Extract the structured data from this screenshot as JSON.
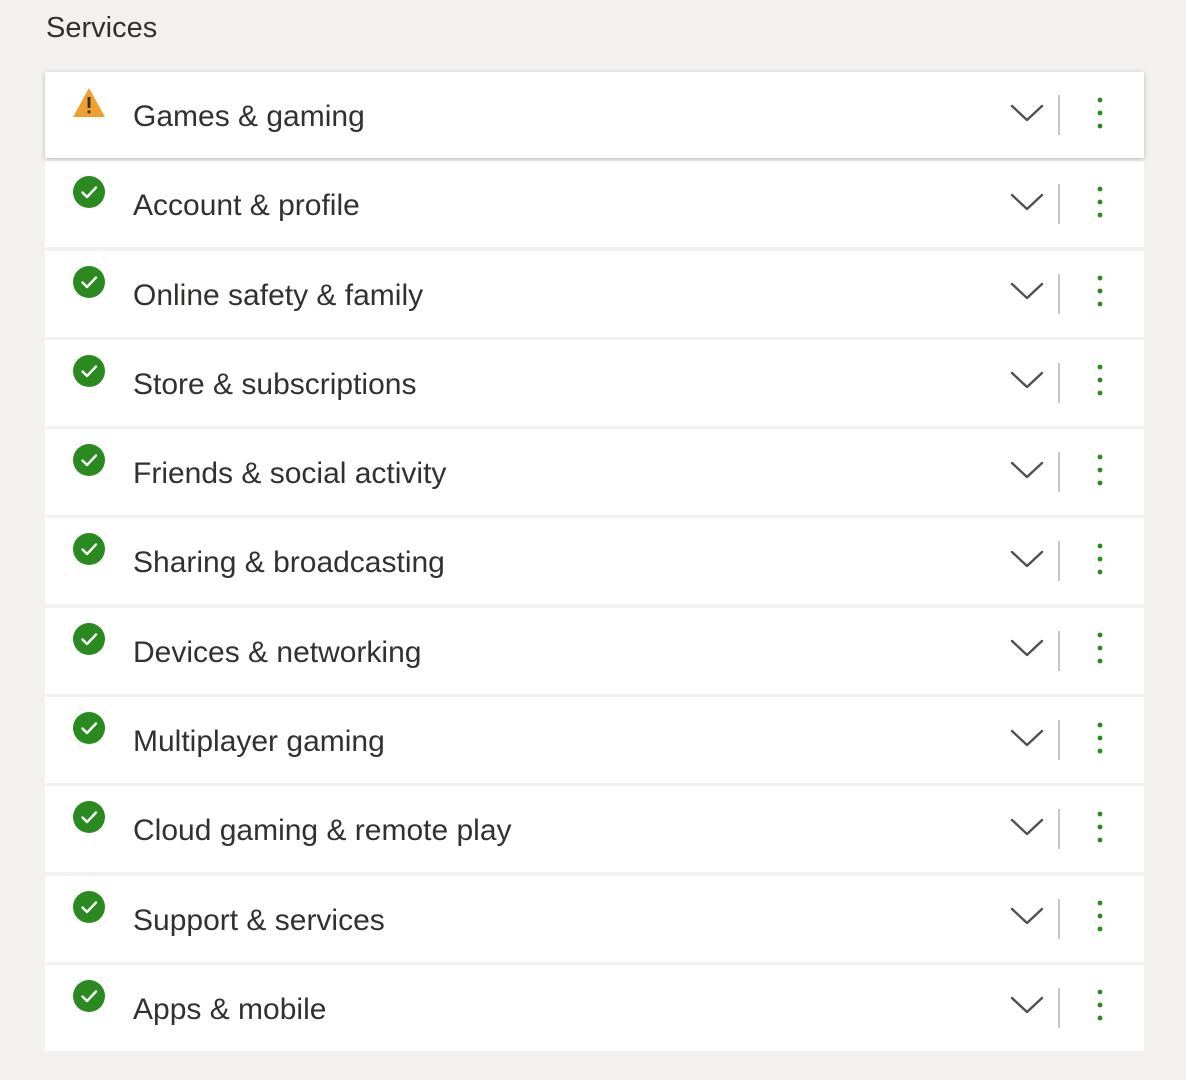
{
  "section": {
    "title": "Services"
  },
  "colors": {
    "ok": "#2b8a1f",
    "warning": "#f0a030",
    "more": "#2b8a1f",
    "chevron": "#505050"
  },
  "services": [
    {
      "label": "Games & gaming",
      "status": "warning",
      "icon": "warning-icon"
    },
    {
      "label": "Account & profile",
      "status": "ok",
      "icon": "check-circle-icon"
    },
    {
      "label": "Online safety & family",
      "status": "ok",
      "icon": "check-circle-icon"
    },
    {
      "label": "Store & subscriptions",
      "status": "ok",
      "icon": "check-circle-icon"
    },
    {
      "label": "Friends & social activity",
      "status": "ok",
      "icon": "check-circle-icon"
    },
    {
      "label": "Sharing & broadcasting",
      "status": "ok",
      "icon": "check-circle-icon"
    },
    {
      "label": "Devices & networking",
      "status": "ok",
      "icon": "check-circle-icon"
    },
    {
      "label": "Multiplayer gaming",
      "status": "ok",
      "icon": "check-circle-icon"
    },
    {
      "label": "Cloud gaming & remote play",
      "status": "ok",
      "icon": "check-circle-icon"
    },
    {
      "label": "Support & services",
      "status": "ok",
      "icon": "check-circle-icon"
    },
    {
      "label": "Apps & mobile",
      "status": "ok",
      "icon": "check-circle-icon"
    }
  ]
}
